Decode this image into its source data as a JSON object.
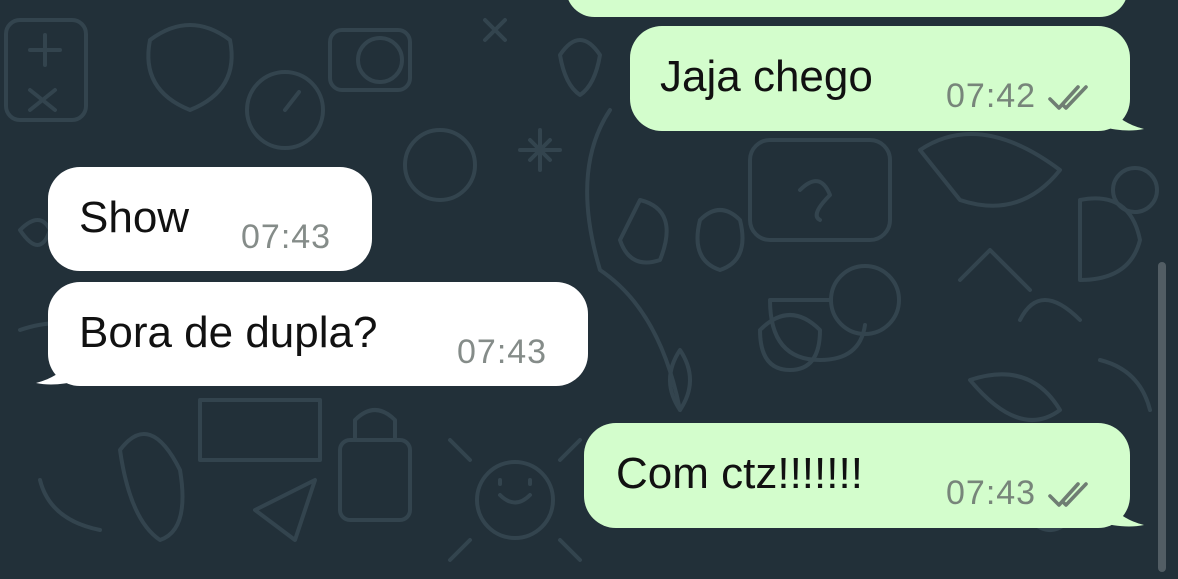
{
  "chat": {
    "messages": [
      {
        "direction": "outgoing",
        "text": "Jaja chego",
        "time": "07:42",
        "status": "read"
      },
      {
        "direction": "incoming",
        "text": "Show",
        "time": "07:43"
      },
      {
        "direction": "incoming",
        "text": "Bora de dupla?",
        "time": "07:43"
      },
      {
        "direction": "outgoing",
        "text": "Com ctz!!!!!!!",
        "time": "07:43",
        "status": "read"
      }
    ]
  },
  "colors": {
    "background": "#223039",
    "incoming_bubble": "#ffffff",
    "outgoing_bubble": "#d3fdcc",
    "timestamp": "#858c89",
    "read_ticks": "#6f7e73"
  },
  "icons": {
    "read_status": "double-check-icon"
  }
}
